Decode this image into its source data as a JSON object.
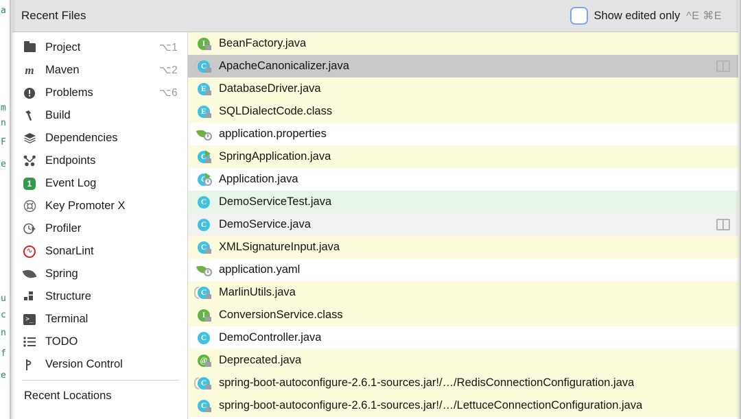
{
  "header": {
    "title": "Recent Files",
    "checkbox_label": "Show edited only",
    "checkbox_checked": false,
    "shortcut": "^E ⌘E",
    "accent": "#7ea6ee",
    "background": "#e4e4e4"
  },
  "sidebar": {
    "items": [
      {
        "label": "Project",
        "shortcut": "⌥1",
        "icon": "folder-icon"
      },
      {
        "label": "Maven",
        "shortcut": "⌥2",
        "icon": "maven-icon"
      },
      {
        "label": "Problems",
        "shortcut": "⌥6",
        "icon": "problems-icon"
      },
      {
        "label": "Build",
        "shortcut": "",
        "icon": "hammer-icon"
      },
      {
        "label": "Dependencies",
        "shortcut": "",
        "icon": "layers-icon"
      },
      {
        "label": "Endpoints",
        "shortcut": "",
        "icon": "endpoints-icon"
      },
      {
        "label": "Event Log",
        "shortcut": "",
        "icon": "event-log-badge-icon",
        "badge": "1"
      },
      {
        "label": "Key Promoter X",
        "shortcut": "",
        "icon": "key-promoter-icon"
      },
      {
        "label": "Profiler",
        "shortcut": "",
        "icon": "profiler-icon"
      },
      {
        "label": "SonarLint",
        "shortcut": "",
        "icon": "sonarlint-icon"
      },
      {
        "label": "Spring",
        "shortcut": "",
        "icon": "spring-leaf-icon"
      },
      {
        "label": "Structure",
        "shortcut": "",
        "icon": "structure-icon"
      },
      {
        "label": "Terminal",
        "shortcut": "",
        "icon": "terminal-icon"
      },
      {
        "label": "TODO",
        "shortcut": "",
        "icon": "todo-list-icon"
      },
      {
        "label": "Version Control",
        "shortcut": "",
        "icon": "branch-icon"
      }
    ],
    "footer_label": "Recent Locations"
  },
  "files": {
    "rows": [
      {
        "name": "BeanFactory.java",
        "icon": "interface-icon",
        "badge": "I",
        "badge_color": "green",
        "locked": true,
        "bg": "yellow",
        "split": false
      },
      {
        "name": "ApacheCanonicalizer.java",
        "icon": "class-icon",
        "badge": "C",
        "badge_color": "cyan",
        "locked": true,
        "bg": "selected",
        "split": true,
        "bracket": true
      },
      {
        "name": "DatabaseDriver.java",
        "icon": "enum-icon",
        "badge": "E",
        "badge_color": "cyan",
        "locked": true,
        "bg": "yellow",
        "split": false
      },
      {
        "name": "SQLDialectCode.class",
        "icon": "enum-icon",
        "badge": "E",
        "badge_color": "cyan",
        "locked": true,
        "bg": "yellow",
        "split": false
      },
      {
        "name": "application.properties",
        "icon": "spring-config-icon",
        "badge": "",
        "badge_color": "",
        "locked": false,
        "bg": "white",
        "split": false,
        "leaf": true,
        "gear": true
      },
      {
        "name": "SpringApplication.java",
        "icon": "runnable-class-icon",
        "badge": "C",
        "badge_color": "cyan",
        "locked": true,
        "bg": "yellow",
        "split": false,
        "run": true
      },
      {
        "name": "Application.java",
        "icon": "spring-runnable-class-icon",
        "badge": "C",
        "badge_color": "cyan",
        "locked": false,
        "bg": "white",
        "split": false,
        "run": true,
        "gear": true
      },
      {
        "name": "DemoServiceTest.java",
        "icon": "test-class-icon",
        "badge": "C",
        "badge_color": "cyan",
        "locked": false,
        "bg": "green",
        "split": false
      },
      {
        "name": "DemoService.java",
        "icon": "class-icon",
        "badge": "C",
        "badge_color": "cyan",
        "locked": false,
        "bg": "grey",
        "split": true
      },
      {
        "name": "XMLSignatureInput.java",
        "icon": "class-icon",
        "badge": "C",
        "badge_color": "cyan",
        "locked": true,
        "bg": "yellow",
        "split": false
      },
      {
        "name": "application.yaml",
        "icon": "spring-config-icon",
        "badge": "",
        "badge_color": "",
        "locked": false,
        "bg": "white",
        "split": false,
        "leaf": true,
        "gear": true
      },
      {
        "name": "MarlinUtils.java",
        "icon": "class-icon",
        "badge": "C",
        "badge_color": "cyan",
        "locked": true,
        "bg": "yellow",
        "split": false,
        "bracket": true
      },
      {
        "name": "ConversionService.class",
        "icon": "interface-icon",
        "badge": "I",
        "badge_color": "green",
        "locked": true,
        "bg": "yellow",
        "split": false
      },
      {
        "name": "DemoController.java",
        "icon": "class-icon",
        "badge": "C",
        "badge_color": "cyan",
        "locked": false,
        "bg": "white",
        "split": false
      },
      {
        "name": "Deprecated.java",
        "icon": "annotation-icon",
        "badge": "@",
        "badge_color": "green",
        "locked": true,
        "bg": "yellow",
        "split": false
      },
      {
        "name": "spring-boot-autoconfigure-2.6.1-sources.jar!/…/RedisConnectionConfiguration.java",
        "icon": "class-icon",
        "badge": "C",
        "badge_color": "cyan",
        "locked": true,
        "bg": "yellow",
        "split": false,
        "bracket": true
      },
      {
        "name": "spring-boot-autoconfigure-2.6.1-sources.jar!/…/LettuceConnectionConfiguration.java",
        "icon": "class-icon",
        "badge": "C",
        "badge_color": "cyan",
        "locked": true,
        "bg": "yellow",
        "split": false
      }
    ],
    "row_colors": {
      "yellow": "#fcfcdc",
      "white": "#ffffff",
      "green": "#e7f6e7",
      "grey": "#f1f1f1",
      "selected": "#c9c9c9"
    }
  },
  "background_editor": {
    "fragments": [
      "a",
      "m",
      "n",
      "F",
      "e",
      "u",
      "c",
      "n",
      "f",
      "e"
    ]
  }
}
